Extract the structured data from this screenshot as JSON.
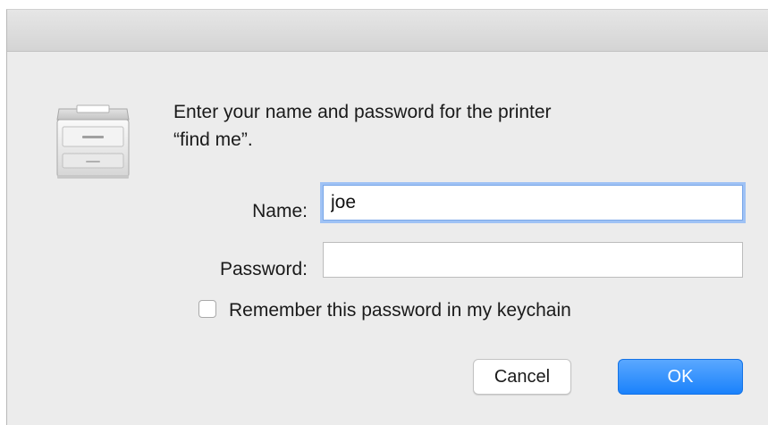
{
  "dialog": {
    "message_line1": "Enter your name and password for the printer",
    "message_line2": "“find me”."
  },
  "form": {
    "name_label": "Name:",
    "name_value": "joe",
    "password_label": "Password:",
    "password_value": "",
    "remember_label": "Remember this password in my keychain",
    "remember_checked": false
  },
  "buttons": {
    "cancel_label": "Cancel",
    "ok_label": "OK"
  },
  "icons": {
    "printer": "printer-icon"
  },
  "colors": {
    "accent": "#1a82fb",
    "focus_ring": "#9fc2f5",
    "dialog_bg": "#ececec"
  }
}
